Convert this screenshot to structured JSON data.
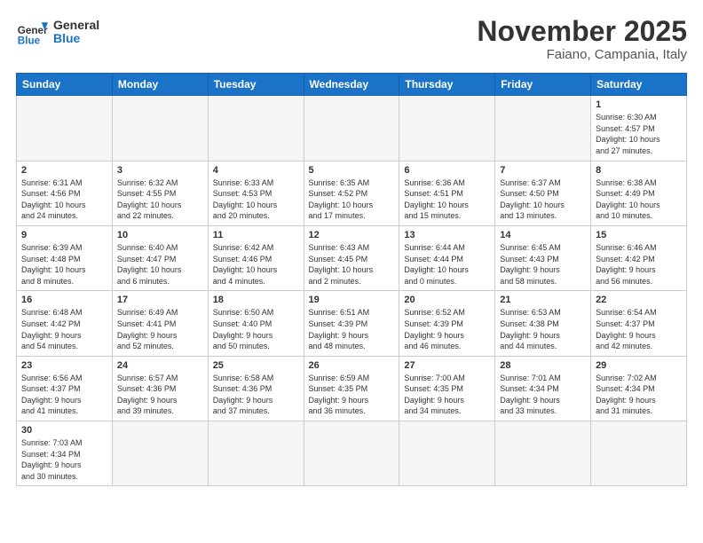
{
  "header": {
    "logo_general": "General",
    "logo_blue": "Blue",
    "month": "November 2025",
    "location": "Faiano, Campania, Italy"
  },
  "weekdays": [
    "Sunday",
    "Monday",
    "Tuesday",
    "Wednesday",
    "Thursday",
    "Friday",
    "Saturday"
  ],
  "weeks": [
    [
      {
        "day": "",
        "info": ""
      },
      {
        "day": "",
        "info": ""
      },
      {
        "day": "",
        "info": ""
      },
      {
        "day": "",
        "info": ""
      },
      {
        "day": "",
        "info": ""
      },
      {
        "day": "",
        "info": ""
      },
      {
        "day": "1",
        "info": "Sunrise: 6:30 AM\nSunset: 4:57 PM\nDaylight: 10 hours\nand 27 minutes."
      }
    ],
    [
      {
        "day": "2",
        "info": "Sunrise: 6:31 AM\nSunset: 4:56 PM\nDaylight: 10 hours\nand 24 minutes."
      },
      {
        "day": "3",
        "info": "Sunrise: 6:32 AM\nSunset: 4:55 PM\nDaylight: 10 hours\nand 22 minutes."
      },
      {
        "day": "4",
        "info": "Sunrise: 6:33 AM\nSunset: 4:53 PM\nDaylight: 10 hours\nand 20 minutes."
      },
      {
        "day": "5",
        "info": "Sunrise: 6:35 AM\nSunset: 4:52 PM\nDaylight: 10 hours\nand 17 minutes."
      },
      {
        "day": "6",
        "info": "Sunrise: 6:36 AM\nSunset: 4:51 PM\nDaylight: 10 hours\nand 15 minutes."
      },
      {
        "day": "7",
        "info": "Sunrise: 6:37 AM\nSunset: 4:50 PM\nDaylight: 10 hours\nand 13 minutes."
      },
      {
        "day": "8",
        "info": "Sunrise: 6:38 AM\nSunset: 4:49 PM\nDaylight: 10 hours\nand 10 minutes."
      }
    ],
    [
      {
        "day": "9",
        "info": "Sunrise: 6:39 AM\nSunset: 4:48 PM\nDaylight: 10 hours\nand 8 minutes."
      },
      {
        "day": "10",
        "info": "Sunrise: 6:40 AM\nSunset: 4:47 PM\nDaylight: 10 hours\nand 6 minutes."
      },
      {
        "day": "11",
        "info": "Sunrise: 6:42 AM\nSunset: 4:46 PM\nDaylight: 10 hours\nand 4 minutes."
      },
      {
        "day": "12",
        "info": "Sunrise: 6:43 AM\nSunset: 4:45 PM\nDaylight: 10 hours\nand 2 minutes."
      },
      {
        "day": "13",
        "info": "Sunrise: 6:44 AM\nSunset: 4:44 PM\nDaylight: 10 hours\nand 0 minutes."
      },
      {
        "day": "14",
        "info": "Sunrise: 6:45 AM\nSunset: 4:43 PM\nDaylight: 9 hours\nand 58 minutes."
      },
      {
        "day": "15",
        "info": "Sunrise: 6:46 AM\nSunset: 4:42 PM\nDaylight: 9 hours\nand 56 minutes."
      }
    ],
    [
      {
        "day": "16",
        "info": "Sunrise: 6:48 AM\nSunset: 4:42 PM\nDaylight: 9 hours\nand 54 minutes."
      },
      {
        "day": "17",
        "info": "Sunrise: 6:49 AM\nSunset: 4:41 PM\nDaylight: 9 hours\nand 52 minutes."
      },
      {
        "day": "18",
        "info": "Sunrise: 6:50 AM\nSunset: 4:40 PM\nDaylight: 9 hours\nand 50 minutes."
      },
      {
        "day": "19",
        "info": "Sunrise: 6:51 AM\nSunset: 4:39 PM\nDaylight: 9 hours\nand 48 minutes."
      },
      {
        "day": "20",
        "info": "Sunrise: 6:52 AM\nSunset: 4:39 PM\nDaylight: 9 hours\nand 46 minutes."
      },
      {
        "day": "21",
        "info": "Sunrise: 6:53 AM\nSunset: 4:38 PM\nDaylight: 9 hours\nand 44 minutes."
      },
      {
        "day": "22",
        "info": "Sunrise: 6:54 AM\nSunset: 4:37 PM\nDaylight: 9 hours\nand 42 minutes."
      }
    ],
    [
      {
        "day": "23",
        "info": "Sunrise: 6:56 AM\nSunset: 4:37 PM\nDaylight: 9 hours\nand 41 minutes."
      },
      {
        "day": "24",
        "info": "Sunrise: 6:57 AM\nSunset: 4:36 PM\nDaylight: 9 hours\nand 39 minutes."
      },
      {
        "day": "25",
        "info": "Sunrise: 6:58 AM\nSunset: 4:36 PM\nDaylight: 9 hours\nand 37 minutes."
      },
      {
        "day": "26",
        "info": "Sunrise: 6:59 AM\nSunset: 4:35 PM\nDaylight: 9 hours\nand 36 minutes."
      },
      {
        "day": "27",
        "info": "Sunrise: 7:00 AM\nSunset: 4:35 PM\nDaylight: 9 hours\nand 34 minutes."
      },
      {
        "day": "28",
        "info": "Sunrise: 7:01 AM\nSunset: 4:34 PM\nDaylight: 9 hours\nand 33 minutes."
      },
      {
        "day": "29",
        "info": "Sunrise: 7:02 AM\nSunset: 4:34 PM\nDaylight: 9 hours\nand 31 minutes."
      }
    ],
    [
      {
        "day": "30",
        "info": "Sunrise: 7:03 AM\nSunset: 4:34 PM\nDaylight: 9 hours\nand 30 minutes."
      },
      {
        "day": "",
        "info": ""
      },
      {
        "day": "",
        "info": ""
      },
      {
        "day": "",
        "info": ""
      },
      {
        "day": "",
        "info": ""
      },
      {
        "day": "",
        "info": ""
      },
      {
        "day": "",
        "info": ""
      }
    ]
  ]
}
